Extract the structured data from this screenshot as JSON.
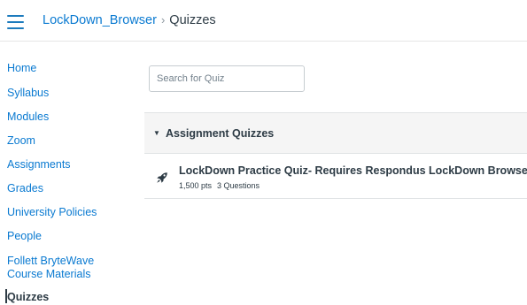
{
  "header": {
    "menu_icon": "hamburger-menu-icon",
    "breadcrumb": {
      "course": "LockDown_Browser",
      "separator": "›",
      "current": "Quizzes"
    }
  },
  "sidebar": {
    "items": [
      {
        "label": "Home"
      },
      {
        "label": "Syllabus"
      },
      {
        "label": "Modules"
      },
      {
        "label": "Zoom"
      },
      {
        "label": "Assignments"
      },
      {
        "label": "Grades"
      },
      {
        "label": "University Policies"
      },
      {
        "label": "People"
      },
      {
        "label": "Follett BryteWave",
        "label2": "Course Materials"
      },
      {
        "label": "Quizzes",
        "active": true
      }
    ]
  },
  "search": {
    "placeholder": "Search for Quiz",
    "value": ""
  },
  "quiz_group": {
    "caret": "▼",
    "title": "Assignment Quizzes",
    "quizzes": [
      {
        "icon": "rocket-quiz-icon",
        "title": "LockDown Practice Quiz- Requires Respondus LockDown Browser",
        "points": "1,500 pts",
        "questions": "3 Questions"
      }
    ]
  },
  "colors": {
    "link": "#0a7ad1",
    "text": "#2d3b45",
    "group_bg": "#f5f5f5"
  }
}
